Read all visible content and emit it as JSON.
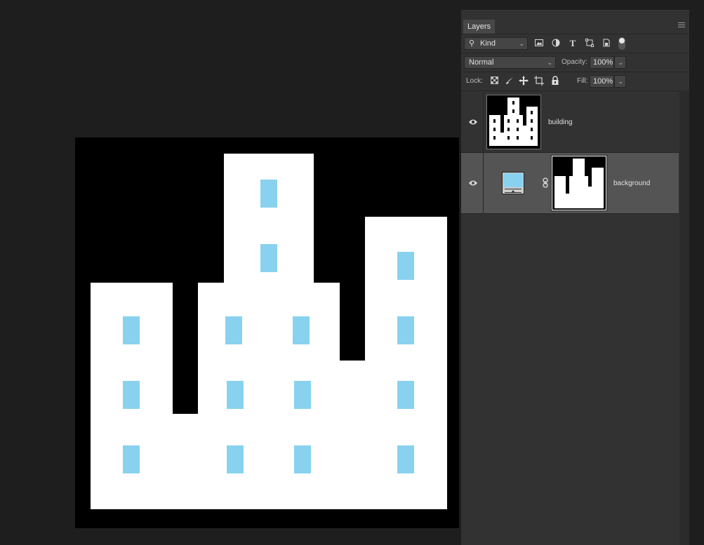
{
  "panel": {
    "tab_label": "Layers",
    "collapse_glyph": "‹‹",
    "close_glyph": "✕",
    "filter": {
      "label": "Kind",
      "icons": [
        "image-filter-icon",
        "adjustment-filter-icon",
        "type-filter-icon",
        "shape-filter-icon",
        "smart-object-filter-icon",
        "filter-toggle-icon"
      ]
    },
    "blend_mode": "Normal",
    "opacity_label": "Opacity:",
    "opacity_value": "100%",
    "lock_label": "Lock:",
    "lock_icons": [
      "lock-transparent-icon",
      "lock-image-icon",
      "lock-position-icon",
      "lock-artboard-icon",
      "lock-all-icon"
    ],
    "fill_label": "Fill:",
    "fill_value": "100%"
  },
  "layers": [
    {
      "name": "building",
      "visible": true,
      "selected": false,
      "type": "pixel"
    },
    {
      "name": "background",
      "visible": true,
      "selected": true,
      "type": "solid-color-fill-with-mask",
      "fill_color": "#89d2ef"
    }
  ],
  "colors": {
    "canvas_bg": "#000000",
    "building": "#ffffff",
    "window": "#89d2ef",
    "panel_bg": "#323232",
    "selected_row": "#545454"
  }
}
